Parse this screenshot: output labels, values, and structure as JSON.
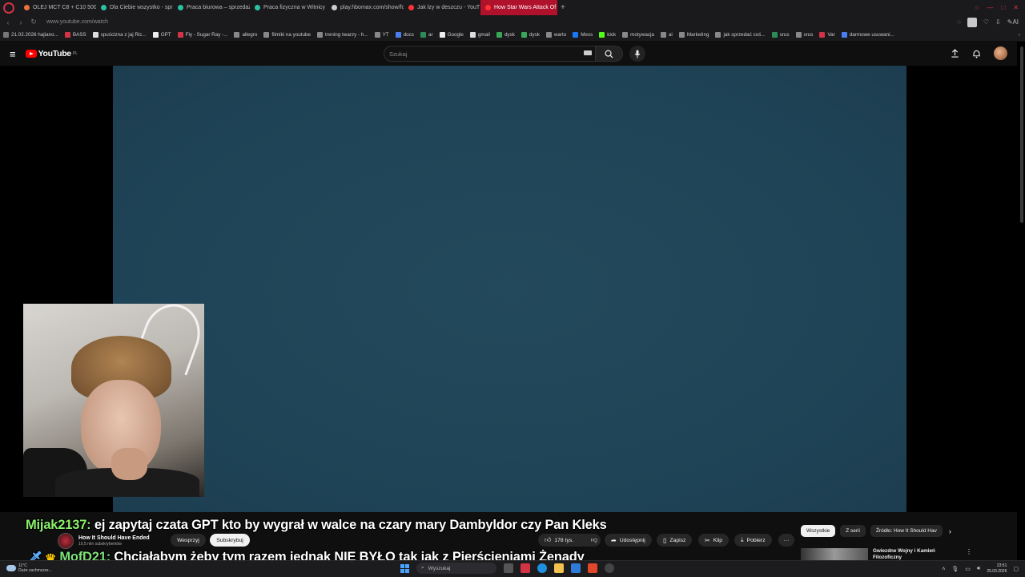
{
  "browser": {
    "tabs": [
      {
        "title": "OLEJ MCT C8 + C10 500",
        "color": "#e8743b",
        "active": false
      },
      {
        "title": "Dla Ciebie wszystko - sprz",
        "color": "#2ac3a2",
        "active": false
      },
      {
        "title": "Praca biurowa – sprzedaż",
        "color": "#2ac3a2",
        "active": false
      },
      {
        "title": "Praca fizyczna w Witnicy",
        "color": "#2ac3a2",
        "active": false
      },
      {
        "title": "play.hbomax.com/show/fc",
        "color": "#cccccc",
        "active": false
      },
      {
        "title": "Jak łzy w deszczu - YouT",
        "color": "#ff3333",
        "active": false
      },
      {
        "title": "How Star Wars Attack Of",
        "color": "#ff3333",
        "active": true
      }
    ],
    "new_tab": "+",
    "url": "www.youtube.com/watch",
    "ai_label": "AI",
    "bookmarks": [
      "21.02.2026 hajiano...",
      "BASS",
      "spuścizna z jaj Ric...",
      "GPT",
      "Fly - Sugar Ray -...",
      "allegro",
      "filmiki na youtube",
      "trening twarzy - h...",
      "YT",
      "docs",
      "ar",
      "Google",
      "gmail",
      "dysk",
      "dysk",
      "warto",
      "Mess",
      "kick",
      "motywacja",
      "ai",
      "Marketing",
      "jak sprzedać coś...",
      "srus",
      "srus",
      "Var",
      "darmowe usuwani..."
    ]
  },
  "youtube": {
    "logo": "YouTube",
    "region": "PL",
    "search_placeholder": "Szukaj",
    "channel_name": "How It Should Have Ended",
    "subscribers": "10,5 mln subskrybentów",
    "support_label": "Wesprzyj",
    "subscribe_label": "Subskrybuj",
    "likes": "178 tys.",
    "share_label": "Udostępnij",
    "save_label": "Zapisz",
    "clip_label": "Klip",
    "download_label": "Pobierz",
    "chips": [
      "Wszystkie",
      "Z serii",
      "Źródło: How It Should Hav"
    ],
    "rec_title": "Gwiezdne Wojny i Kamień Filozoficzny"
  },
  "chat": {
    "line1_user": "Mijak2137:",
    "line1_msg": " ej zapytaj czata GPT kto by wygrał w walce na czary mary Dambyldor czy Pan Kleks",
    "line2_user": "MofD21:",
    "line2_msg": " Chciałabym żeby tym razem jednak NIE BYŁO tak jak z Pierścieniami Żenady"
  },
  "taskbar": {
    "weather_temp": "11°C",
    "weather_desc": "Duże zachmurze...",
    "search_label": "Wyszukaj",
    "time": "23:51",
    "date": "25.03.2026"
  }
}
